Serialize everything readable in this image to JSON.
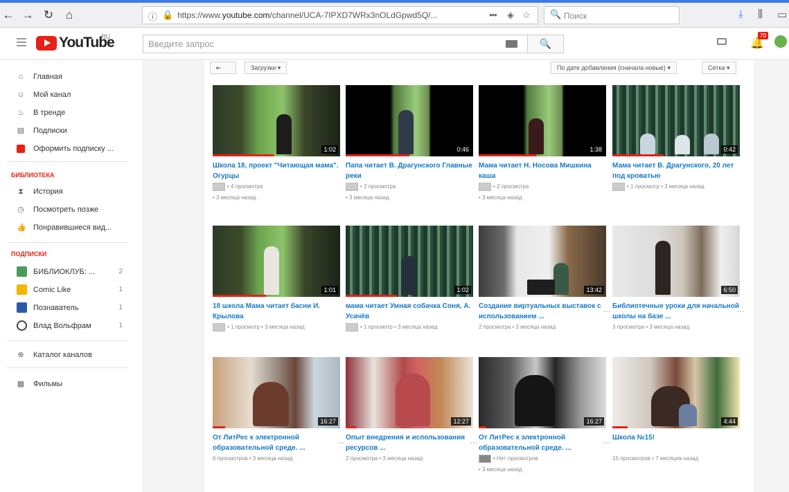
{
  "browser": {
    "url_prefix": "https://www.",
    "url_domain": "youtube.com",
    "url_path": "/channel/UCA-7IPXD7WRx3nOLdGpwd5Q/...",
    "more": "•••",
    "search_placeholder": "Поиск"
  },
  "header": {
    "logo": "YouTube",
    "logo_region": "RU",
    "search_placeholder": "Введите запрос",
    "notification_count": "70"
  },
  "sidebar": {
    "nav": [
      {
        "label": "Главная",
        "icon": "home-icon"
      },
      {
        "label": "Мой канал",
        "icon": "user-icon"
      },
      {
        "label": "В тренде",
        "icon": "flame-icon"
      },
      {
        "label": "Подписки",
        "icon": "subscriptions-icon"
      },
      {
        "label": "Оформить подписку ...",
        "icon": "premium-icon"
      }
    ],
    "library_heading": "БИБЛИОТЕКА",
    "library": [
      {
        "label": "История",
        "icon": "hourglass-icon"
      },
      {
        "label": "Посмотреть позже",
        "icon": "clock-icon"
      },
      {
        "label": "Понравившиеся вид...",
        "icon": "thumb-up-icon"
      }
    ],
    "subscriptions_heading": "ПОДПИСКИ",
    "subscriptions": [
      {
        "label": "БИБЛИОКЛУБ: ...",
        "count": "2",
        "color": "#4a9b5a"
      },
      {
        "label": "Comic Like",
        "count": "1",
        "color": "#f2b705"
      },
      {
        "label": "Познаватель",
        "count": "1",
        "color": "#2a5aa8"
      },
      {
        "label": "Влад Вольфрам",
        "count": "1",
        "color": "#444444"
      }
    ],
    "extra": [
      {
        "label": "Каталог каналов",
        "icon": "plus-circle-icon"
      },
      {
        "label": "Фильмы",
        "icon": "film-icon"
      }
    ]
  },
  "toolbar": {
    "uploads": "Загрузки",
    "sort": "По дате добавления (сначала новые)",
    "view": "Сетка"
  },
  "videos": [
    {
      "title": "Школа 18, проект \"Читающая мама\". Огурцы",
      "views": "4 просмотра",
      "age": "3 месяца назад",
      "duration": "1:02",
      "progress": 0.48
    },
    {
      "title": "Папа читает В. Драгунского Главные реки",
      "views": "2 просмотра",
      "age": "3 месяца назад",
      "duration": "0:46",
      "progress": 0.5
    },
    {
      "title": "Мама читает Н. Носова Мишкина каша",
      "views": "2 просмотра",
      "age": "3 месяца назад",
      "duration": "1:38",
      "progress": 0.45
    },
    {
      "title": "Мама читает В. Драгунского, 20 лет под кроватью",
      "views": "1 просмотр",
      "age": "3 месяца назад",
      "duration": "0:42",
      "progress": 0.4
    },
    {
      "title": "18 школа Мама читает басни И. Крылова",
      "views": "1 просмотр",
      "age": "3 месяца назад",
      "duration": "1:01",
      "progress": 0.42
    },
    {
      "title": "мама читает Умная собачка Соня, А. Усачёв",
      "views": "1 просмотр",
      "age": "3 месяца назад",
      "duration": "1:02",
      "progress": 0.4
    },
    {
      "title": "Создание виртуальных выставок с использованием ...",
      "views": "2 просмотра",
      "age": "3 месяца назад",
      "duration": "13:42",
      "progress": 0.0
    },
    {
      "title": "Библиотечные уроки для начальной школы на базе ...",
      "views": "3 просмотра",
      "age": "3 месяца назад",
      "duration": "6:50",
      "progress": 0.0
    },
    {
      "title": "От ЛитРес к электронной образовательной среде. ...",
      "views": "6 просмотров",
      "age": "3 месяца назад",
      "duration": "16:27",
      "progress": 0.1
    },
    {
      "title": "Опыт внедрения и использования ресурсов ...",
      "views": "2 просмотра",
      "age": "3 месяца назад",
      "duration": "12:27",
      "progress": 0.08
    },
    {
      "title": "От ЛитРес к электронной образовательной среде. ...",
      "views": "Нет просмотров",
      "age": "3 месяца назад",
      "duration": "16:27",
      "progress": 0.06
    },
    {
      "title": "Школа №15!",
      "views": "15 просмотров",
      "age": "7 месяцев назад",
      "duration": "4:44",
      "progress": 0.12
    }
  ]
}
